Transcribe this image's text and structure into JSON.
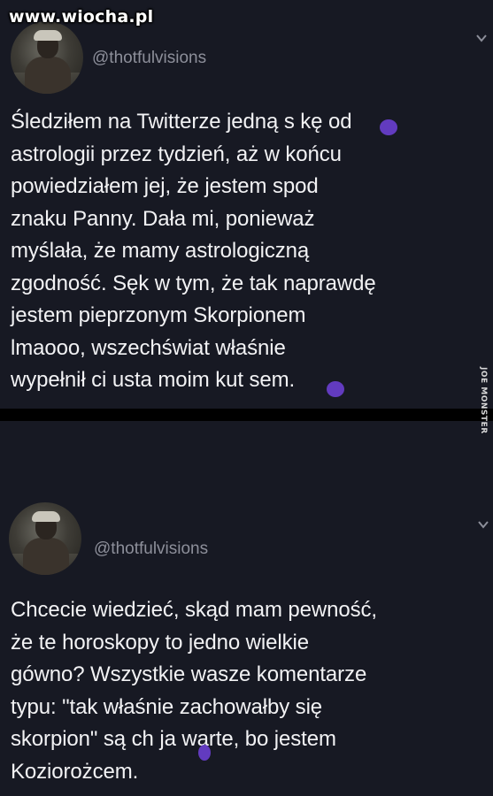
{
  "watermark": "www.wiocha.pl",
  "side_watermark": "JOE MONSTER",
  "colors": {
    "background": "#171923",
    "divider": "#000000",
    "text": "#f2f2f4",
    "handle": "#8d8f9a",
    "blot": "#6a3fd0"
  },
  "tweets": [
    {
      "handle": "@thotfulvisions",
      "menu_icon": "chevron-down-icon",
      "text": "Śledziłem na Twitterze jedną s kę od\nastrologii przez tydzień, aż w końcu\npowiedziałem jej, że jestem spod\nznaku Panny. Dała mi, ponieważ\nmyślała, że mamy astrologiczną\nzgodność. Sęk w tym, że tak naprawdę\njestem pieprzonym Skorpionem\nlmaooo, wszechświat właśnie\nwypełnił ci usta moim kut sem."
    },
    {
      "handle": "@thotfulvisions",
      "menu_icon": "chevron-down-icon",
      "text": "Chcecie wiedzieć, skąd mam pewność,\nże te horoskopy to jedno wielkie\ngówno? Wszystkie wasze komentarze\ntypu: \"tak właśnie zachowałby się\nskorpion\" są ch ja warte, bo jestem\nKoziorożcem."
    }
  ]
}
